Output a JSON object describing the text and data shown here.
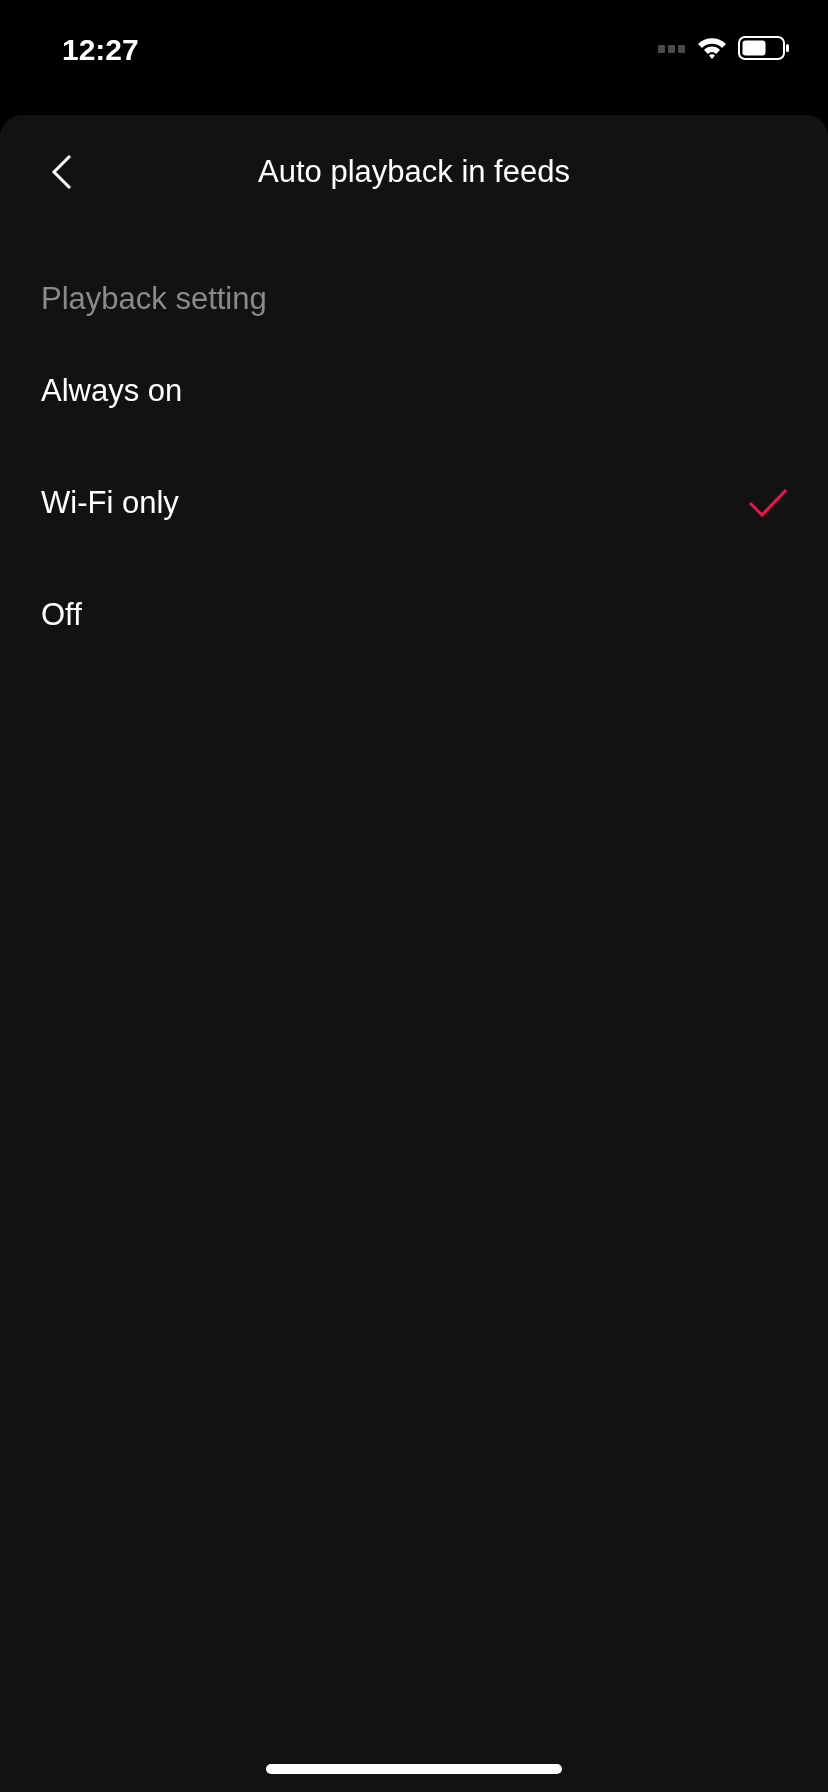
{
  "status_bar": {
    "time": "12:27"
  },
  "header": {
    "title": "Auto playback in feeds"
  },
  "section": {
    "title": "Playback setting"
  },
  "options": [
    {
      "label": "Always on",
      "selected": false
    },
    {
      "label": "Wi-Fi only",
      "selected": true
    },
    {
      "label": "Off",
      "selected": false
    }
  ]
}
